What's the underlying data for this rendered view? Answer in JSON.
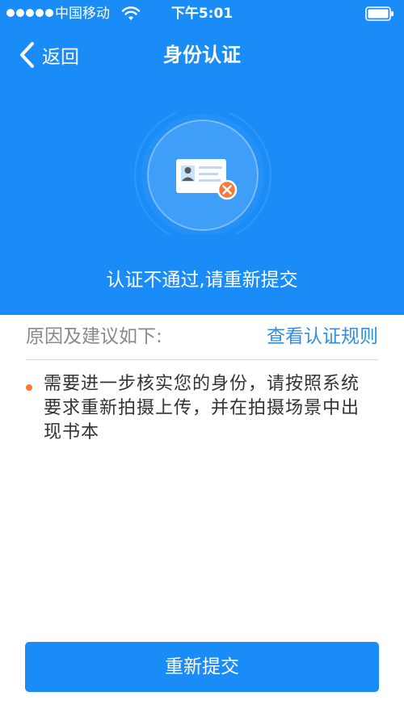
{
  "status_bar": {
    "carrier": "中国移动",
    "time": "下午5:01",
    "signal_bars": 5,
    "icons": [
      "wifi-icon",
      "battery-icon"
    ]
  },
  "nav": {
    "back_label": "返回",
    "title": "身份认证",
    "back_icon": "chevron-left-icon"
  },
  "result": {
    "icon": "id-card-rejected-icon",
    "message": "认证不通过,请重新提交"
  },
  "reasons": {
    "title": "原因及建议如下:",
    "rules_link": "查看认证规则",
    "items": [
      "需要进一步核实您的身份，请按照系统要求重新拍摄上传，并在拍摄场景中出现书本"
    ]
  },
  "actions": {
    "resubmit_label": "重新提交"
  },
  "colors": {
    "primary": "#1a8cf7",
    "link": "#2f8ee6",
    "error": "#f5793a",
    "bullet": "#ff7a2e"
  }
}
